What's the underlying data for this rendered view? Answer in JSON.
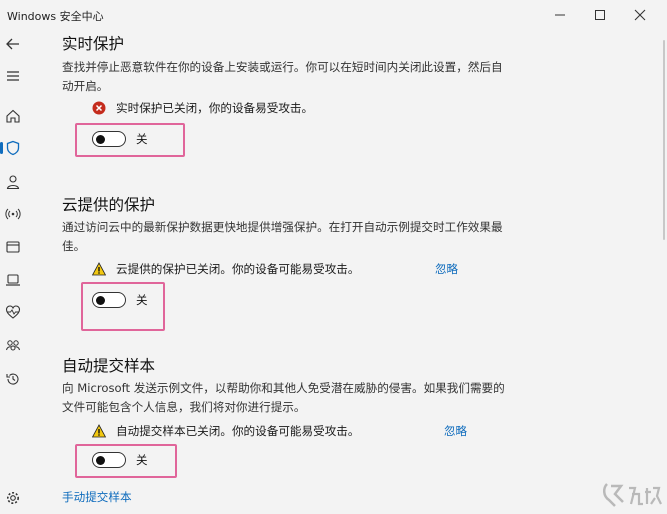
{
  "window": {
    "title": "Windows 安全中心"
  },
  "sections": [
    {
      "title": "实时保护",
      "description": "查找并停止恶意软件在你的设备上安装或运行。你可以在短时间内关闭此设置，然后自动开启。",
      "status_text": "实时保护已关闭，你的设备易受攻击。",
      "status_icon": "error-icon",
      "toggle_label": "关",
      "toggle_on": false
    },
    {
      "title": "云提供的保护",
      "description": "通过访问云中的最新保护数据更快地提供增强保护。在打开自动示例提交时工作效果最佳。",
      "status_text": "云提供的保护已关闭。你的设备可能易受攻击。",
      "status_icon": "warning-icon",
      "dismiss_label": "忽略",
      "toggle_label": "关",
      "toggle_on": false
    },
    {
      "title": "自动提交样本",
      "description": "向 Microsoft 发送示例文件，以帮助你和其他人免受潜在威胁的侵害。如果我们需要的文件可能包含个人信息，我们将对你进行提示。",
      "status_text": "自动提交样本已关闭。你的设备可能易受攻击。",
      "status_icon": "warning-icon",
      "dismiss_label": "忽略",
      "toggle_label": "关",
      "toggle_on": false,
      "link_text": "手动提交样本"
    }
  ],
  "colors": {
    "accent": "#0f6cbd",
    "error": "#c42b1c",
    "warning": "#f2c811",
    "highlight": "#e0659a"
  },
  "watermark": "九游"
}
